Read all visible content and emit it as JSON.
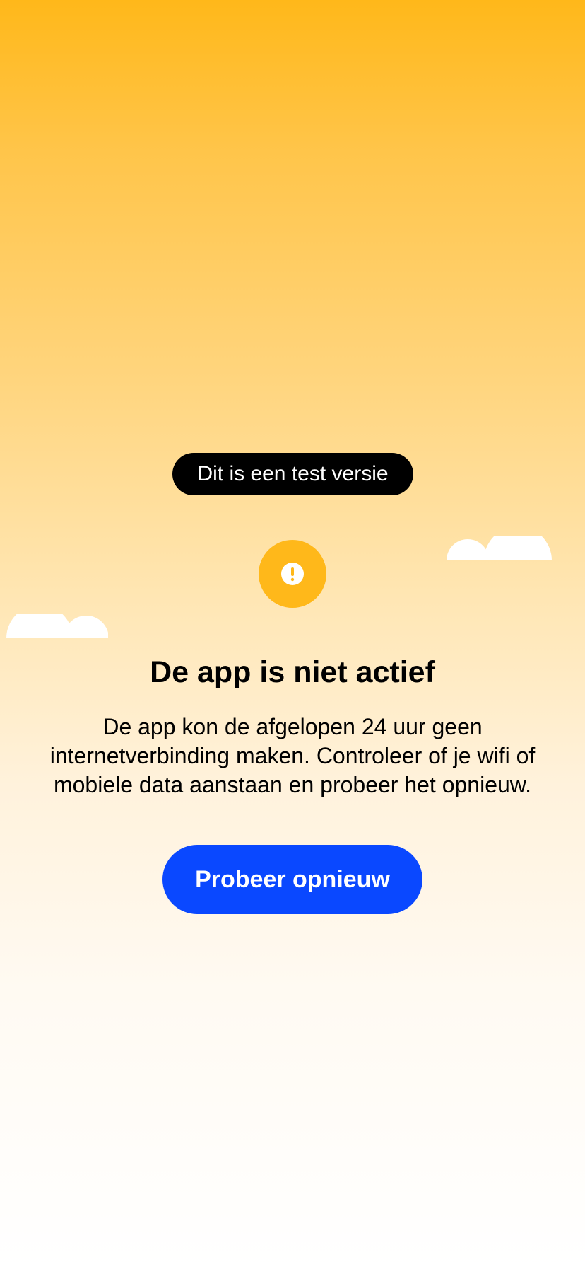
{
  "badge": {
    "label": "Dit is een test versie"
  },
  "status": {
    "icon": "exclamation-icon",
    "title": "De app is niet actief",
    "message": "De app kon de afgelopen 24 uur geen internetverbinding maken. Controleer of je wifi of mobiele data aanstaan en probeer het opnieuw."
  },
  "actions": {
    "retry_label": "Probeer opnieuw"
  },
  "colors": {
    "accent_yellow": "#FFB81A",
    "button_blue": "#0A48FF",
    "badge_black": "#000000"
  }
}
